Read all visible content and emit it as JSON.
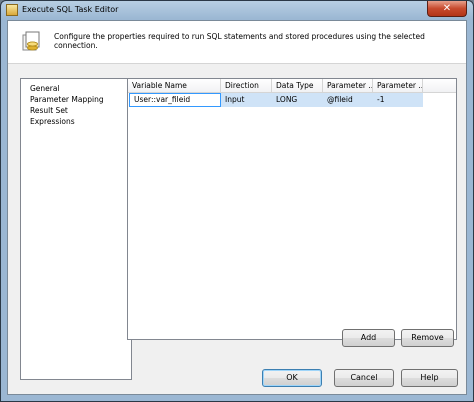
{
  "window": {
    "title": "Execute SQL Task Editor",
    "close_glyph": "✕"
  },
  "header": {
    "icon": "sql-task-icon",
    "description": "Configure the properties required to run SQL statements and stored procedures using the selected connection."
  },
  "nav": {
    "items": [
      {
        "label": "General"
      },
      {
        "label": "Parameter Mapping"
      },
      {
        "label": "Result Set"
      },
      {
        "label": "Expressions"
      }
    ]
  },
  "grid": {
    "columns": [
      "Variable Name",
      "Direction",
      "Data Type",
      "Parameter ...",
      "Parameter ..."
    ],
    "rows": [
      {
        "variable_name": "User::var_fileid",
        "direction": "Input",
        "data_type": "LONG",
        "parameter_name": "@fileid",
        "parameter_size": "-1"
      }
    ]
  },
  "buttons": {
    "add": "Add",
    "remove": "Remove",
    "ok": "OK",
    "cancel": "Cancel",
    "help": "Help"
  },
  "colors": {
    "selection": "#cfe3f7",
    "focus_border": "#3399ff"
  }
}
